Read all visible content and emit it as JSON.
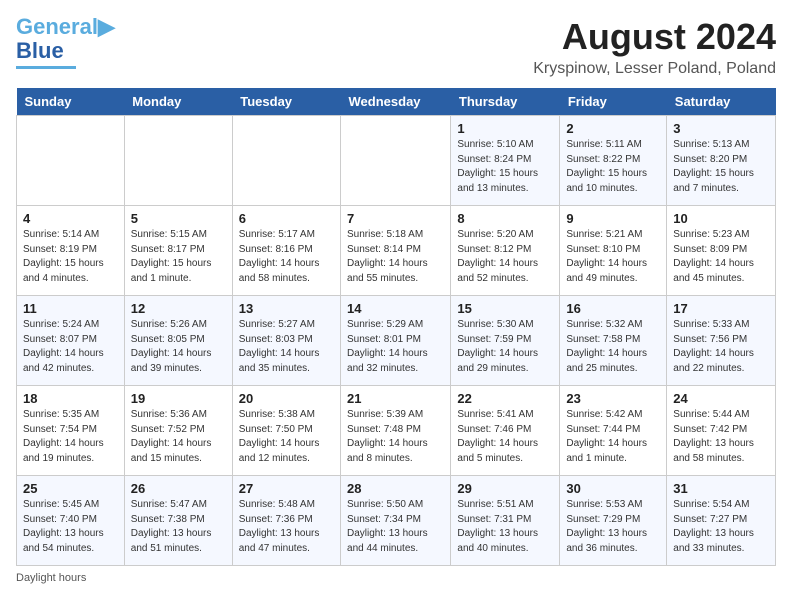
{
  "header": {
    "logo_line1": "General",
    "logo_line2": "Blue",
    "month_title": "August 2024",
    "location": "Kryspinow, Lesser Poland, Poland"
  },
  "days_of_week": [
    "Sunday",
    "Monday",
    "Tuesday",
    "Wednesday",
    "Thursday",
    "Friday",
    "Saturday"
  ],
  "weeks": [
    [
      {
        "day": "",
        "info": ""
      },
      {
        "day": "",
        "info": ""
      },
      {
        "day": "",
        "info": ""
      },
      {
        "day": "",
        "info": ""
      },
      {
        "day": "1",
        "info": "Sunrise: 5:10 AM\nSunset: 8:24 PM\nDaylight: 15 hours\nand 13 minutes."
      },
      {
        "day": "2",
        "info": "Sunrise: 5:11 AM\nSunset: 8:22 PM\nDaylight: 15 hours\nand 10 minutes."
      },
      {
        "day": "3",
        "info": "Sunrise: 5:13 AM\nSunset: 8:20 PM\nDaylight: 15 hours\nand 7 minutes."
      }
    ],
    [
      {
        "day": "4",
        "info": "Sunrise: 5:14 AM\nSunset: 8:19 PM\nDaylight: 15 hours\nand 4 minutes."
      },
      {
        "day": "5",
        "info": "Sunrise: 5:15 AM\nSunset: 8:17 PM\nDaylight: 15 hours\nand 1 minute."
      },
      {
        "day": "6",
        "info": "Sunrise: 5:17 AM\nSunset: 8:16 PM\nDaylight: 14 hours\nand 58 minutes."
      },
      {
        "day": "7",
        "info": "Sunrise: 5:18 AM\nSunset: 8:14 PM\nDaylight: 14 hours\nand 55 minutes."
      },
      {
        "day": "8",
        "info": "Sunrise: 5:20 AM\nSunset: 8:12 PM\nDaylight: 14 hours\nand 52 minutes."
      },
      {
        "day": "9",
        "info": "Sunrise: 5:21 AM\nSunset: 8:10 PM\nDaylight: 14 hours\nand 49 minutes."
      },
      {
        "day": "10",
        "info": "Sunrise: 5:23 AM\nSunset: 8:09 PM\nDaylight: 14 hours\nand 45 minutes."
      }
    ],
    [
      {
        "day": "11",
        "info": "Sunrise: 5:24 AM\nSunset: 8:07 PM\nDaylight: 14 hours\nand 42 minutes."
      },
      {
        "day": "12",
        "info": "Sunrise: 5:26 AM\nSunset: 8:05 PM\nDaylight: 14 hours\nand 39 minutes."
      },
      {
        "day": "13",
        "info": "Sunrise: 5:27 AM\nSunset: 8:03 PM\nDaylight: 14 hours\nand 35 minutes."
      },
      {
        "day": "14",
        "info": "Sunrise: 5:29 AM\nSunset: 8:01 PM\nDaylight: 14 hours\nand 32 minutes."
      },
      {
        "day": "15",
        "info": "Sunrise: 5:30 AM\nSunset: 7:59 PM\nDaylight: 14 hours\nand 29 minutes."
      },
      {
        "day": "16",
        "info": "Sunrise: 5:32 AM\nSunset: 7:58 PM\nDaylight: 14 hours\nand 25 minutes."
      },
      {
        "day": "17",
        "info": "Sunrise: 5:33 AM\nSunset: 7:56 PM\nDaylight: 14 hours\nand 22 minutes."
      }
    ],
    [
      {
        "day": "18",
        "info": "Sunrise: 5:35 AM\nSunset: 7:54 PM\nDaylight: 14 hours\nand 19 minutes."
      },
      {
        "day": "19",
        "info": "Sunrise: 5:36 AM\nSunset: 7:52 PM\nDaylight: 14 hours\nand 15 minutes."
      },
      {
        "day": "20",
        "info": "Sunrise: 5:38 AM\nSunset: 7:50 PM\nDaylight: 14 hours\nand 12 minutes."
      },
      {
        "day": "21",
        "info": "Sunrise: 5:39 AM\nSunset: 7:48 PM\nDaylight: 14 hours\nand 8 minutes."
      },
      {
        "day": "22",
        "info": "Sunrise: 5:41 AM\nSunset: 7:46 PM\nDaylight: 14 hours\nand 5 minutes."
      },
      {
        "day": "23",
        "info": "Sunrise: 5:42 AM\nSunset: 7:44 PM\nDaylight: 14 hours\nand 1 minute."
      },
      {
        "day": "24",
        "info": "Sunrise: 5:44 AM\nSunset: 7:42 PM\nDaylight: 13 hours\nand 58 minutes."
      }
    ],
    [
      {
        "day": "25",
        "info": "Sunrise: 5:45 AM\nSunset: 7:40 PM\nDaylight: 13 hours\nand 54 minutes."
      },
      {
        "day": "26",
        "info": "Sunrise: 5:47 AM\nSunset: 7:38 PM\nDaylight: 13 hours\nand 51 minutes."
      },
      {
        "day": "27",
        "info": "Sunrise: 5:48 AM\nSunset: 7:36 PM\nDaylight: 13 hours\nand 47 minutes."
      },
      {
        "day": "28",
        "info": "Sunrise: 5:50 AM\nSunset: 7:34 PM\nDaylight: 13 hours\nand 44 minutes."
      },
      {
        "day": "29",
        "info": "Sunrise: 5:51 AM\nSunset: 7:31 PM\nDaylight: 13 hours\nand 40 minutes."
      },
      {
        "day": "30",
        "info": "Sunrise: 5:53 AM\nSunset: 7:29 PM\nDaylight: 13 hours\nand 36 minutes."
      },
      {
        "day": "31",
        "info": "Sunrise: 5:54 AM\nSunset: 7:27 PM\nDaylight: 13 hours\nand 33 minutes."
      }
    ]
  ],
  "footer": {
    "note": "Daylight hours"
  }
}
